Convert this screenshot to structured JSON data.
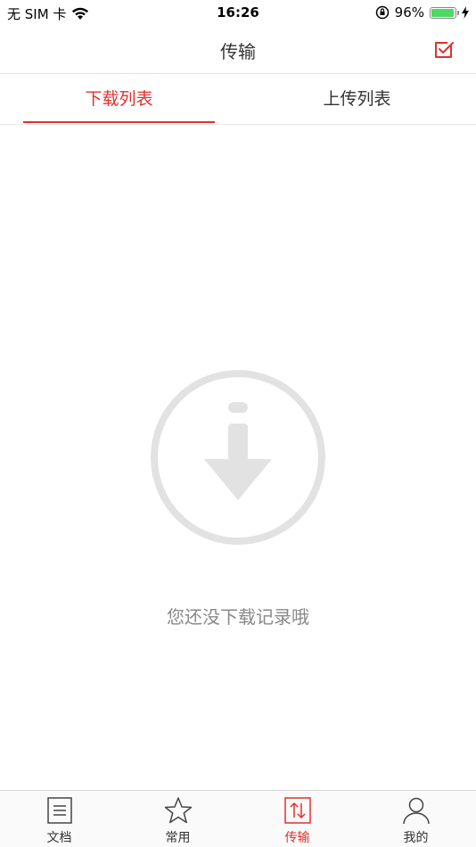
{
  "status": {
    "carrier": "无 SIM 卡",
    "time": "16:26",
    "battery_pct": "96%",
    "battery_level": 0.96
  },
  "nav": {
    "title": "传输"
  },
  "tabs": {
    "download": "下载列表",
    "upload": "上传列表"
  },
  "empty": {
    "message": "您还没下载记录哦"
  },
  "tabbar": {
    "items": [
      {
        "label": "文档"
      },
      {
        "label": "常用"
      },
      {
        "label": "传输"
      },
      {
        "label": "我的"
      }
    ]
  },
  "colors": {
    "accent": "#e0312e",
    "icon_gray": "#e2e2e2"
  }
}
